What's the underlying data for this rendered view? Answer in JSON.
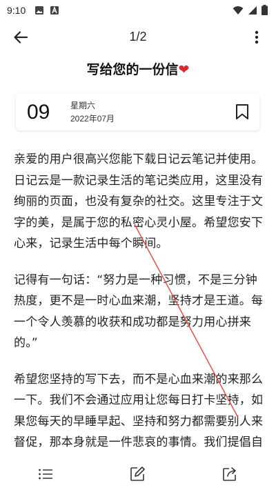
{
  "status_bar": {
    "time": "9:10",
    "icons": [
      "image-icon",
      "a-letter-icon",
      "wifi-icon",
      "signal-icon",
      "battery-icon"
    ]
  },
  "app_bar": {
    "page_indicator": "1/2",
    "back_icon": "arrow-left-icon",
    "more_icon": "more-vertical-icon"
  },
  "letter": {
    "title": "写给您的一份信",
    "title_emoji": "❤",
    "date": {
      "day": "09",
      "weekday": "星期六",
      "month": "2022年07月"
    },
    "paragraphs": [
      "亲爱的用户很高兴您能下载日记云笔记并使用。日记云是一款记录生活的笔记类应用，这里没有绚丽的页面，也没有复杂的社交。这里专注于文字的美，是属于您的私密心灵小屋。希望您安下心来，记录生活中每个瞬间。",
      "记得有一句话：“努力是一种习惯，不是三分钟热度，更不是一时心血来潮，坚持才是王道。每一个令人羡慕的收获和成功都是努力用心拼来的。”",
      "希望您坚持的写下去，而不是心血来潮的来那么一下。我们不会通过应用让您每日打卡坚持，如果您每天的早睡早起、坚持和努力都需要别人来督促，那本身就是一件悲哀的事情。我们提倡自觉，自主以及坚持。"
    ]
  },
  "bottom_bar": {
    "icons": [
      "list-icon",
      "edit-icon",
      "share-icon"
    ]
  },
  "colors": {
    "heart": "#e0262e",
    "annotation_line": "#e8504a"
  }
}
